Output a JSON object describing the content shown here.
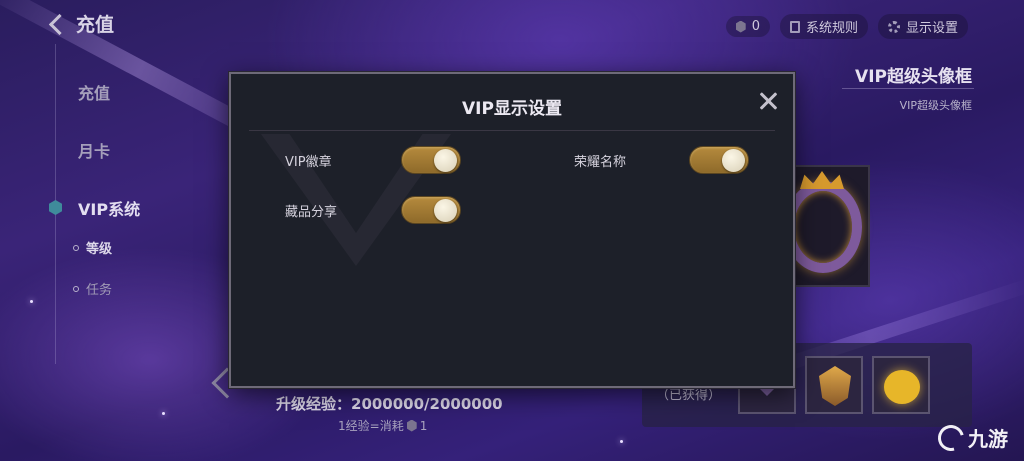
{
  "header": {
    "back_title": "充值",
    "currency_count": "0",
    "rules_label": "系统规则",
    "display_settings_label": "显示设置"
  },
  "sidebar": {
    "items": [
      {
        "label": "充值"
      },
      {
        "label": "月卡"
      },
      {
        "label": "VIP系统"
      }
    ],
    "sub_items": [
      {
        "label": "等级"
      },
      {
        "label": "任务"
      }
    ]
  },
  "detail": {
    "title": "VIP超级头像框",
    "subtitle": "VIP超级头像框"
  },
  "rewards": {
    "obtained_label": "（已获得）"
  },
  "exp": {
    "label": "升级经验：2000000/2000000",
    "note": "1经验=消耗",
    "note_suffix": "1"
  },
  "modal": {
    "title": "VIP显示设置",
    "options": [
      {
        "label": "VIP徽章",
        "enabled": true
      },
      {
        "label": "荣耀名称",
        "enabled": true
      },
      {
        "label": "藏品分享",
        "enabled": true
      }
    ]
  },
  "watermark": {
    "text": "九游"
  },
  "colors": {
    "toggle_on": "#b58a3d",
    "modal_bg": "#1d2029",
    "accent_hex": "#3f8b9b"
  }
}
